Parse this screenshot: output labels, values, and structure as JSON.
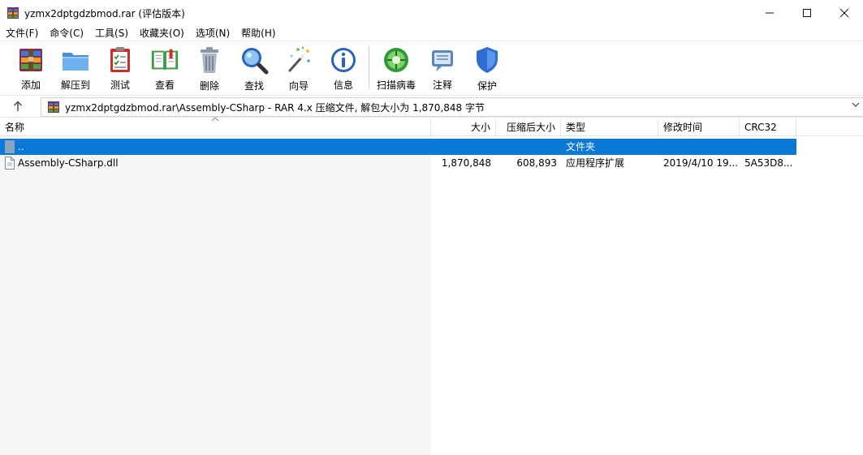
{
  "window": {
    "title": "yzmx2dptgdzbmod.rar (评估版本)",
    "icon": "winrar-icon"
  },
  "menu": [
    {
      "label": "文件(F)"
    },
    {
      "label": "命令(C)"
    },
    {
      "label": "工具(S)"
    },
    {
      "label": "收藏夹(O)"
    },
    {
      "label": "选项(N)"
    },
    {
      "label": "帮助(H)"
    }
  ],
  "toolbar": [
    {
      "label": "添加",
      "icon": "add-archive-icon"
    },
    {
      "label": "解压到",
      "icon": "extract-folder-icon"
    },
    {
      "label": "测试",
      "icon": "test-checklist-icon"
    },
    {
      "label": "查看",
      "icon": "view-book-icon"
    },
    {
      "label": "删除",
      "icon": "trash-icon"
    },
    {
      "label": "查找",
      "icon": "magnifier-icon"
    },
    {
      "label": "向导",
      "icon": "wizard-wand-icon"
    },
    {
      "label": "信息",
      "icon": "info-icon"
    },
    {
      "label": "扫描病毒",
      "icon": "virus-scan-icon"
    },
    {
      "label": "注释",
      "icon": "comment-icon"
    },
    {
      "label": "保护",
      "icon": "shield-icon"
    }
  ],
  "address": {
    "path": "yzmx2dptgdzbmod.rar\\Assembly-CSharp - RAR 4.x 压缩文件, 解包大小为 1,870,848 字节"
  },
  "columns": [
    {
      "label": "名称"
    },
    {
      "label": "大小"
    },
    {
      "label": "压缩后大小"
    },
    {
      "label": "类型"
    },
    {
      "label": "修改时间"
    },
    {
      "label": "CRC32"
    }
  ],
  "rows": [
    {
      "name": "..",
      "size": "",
      "packed": "",
      "type": "文件夹",
      "modified": "",
      "crc": "",
      "selected": true
    },
    {
      "name": "Assembly-CSharp.dll",
      "size": "1,870,848",
      "packed": "608,893",
      "type": "应用程序扩展",
      "modified": "2019/4/10 19...",
      "crc": "5A53D8...",
      "selected": false
    }
  ],
  "colors": {
    "selection": "#0a78d7"
  }
}
